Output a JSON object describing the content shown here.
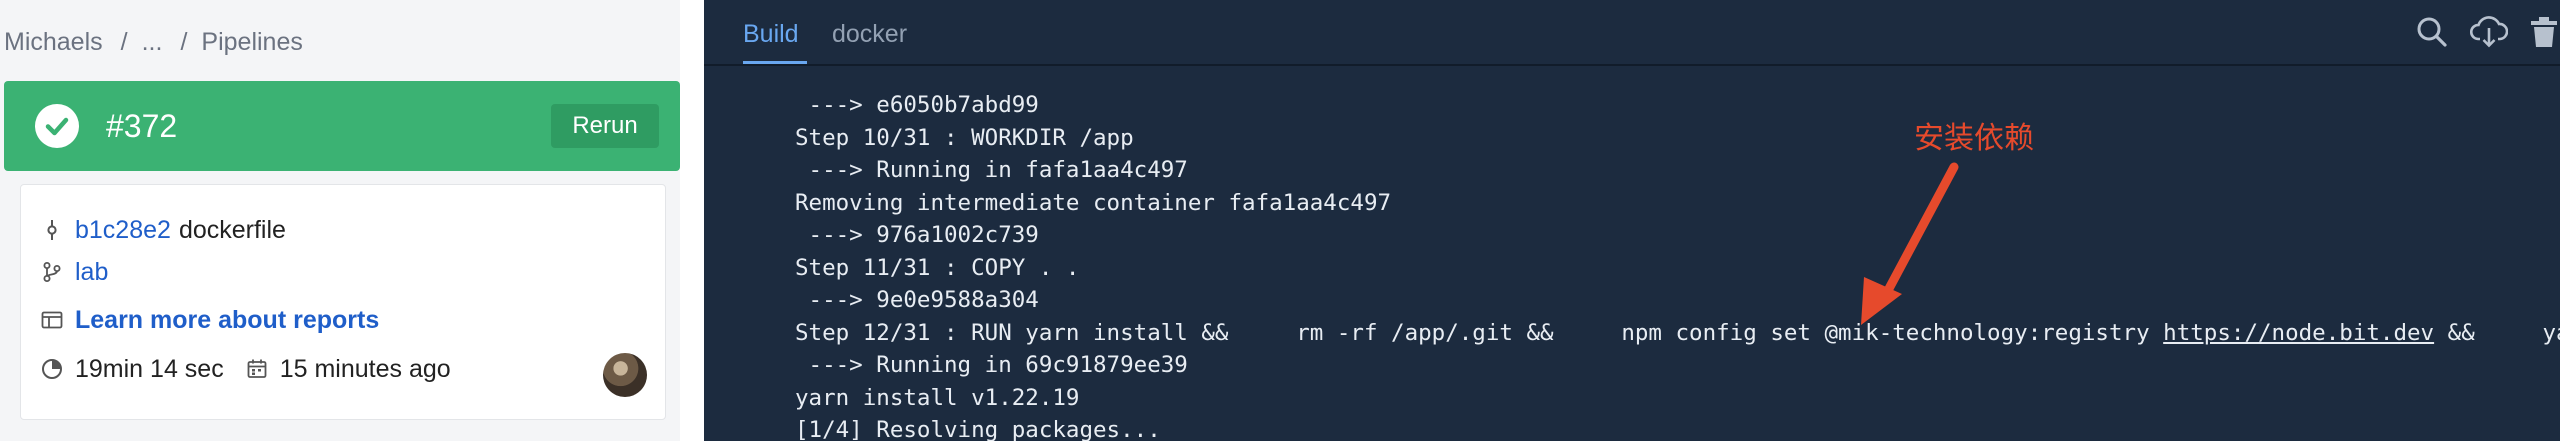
{
  "breadcrumb": {
    "items": [
      "Michaels",
      "...",
      "Pipelines"
    ],
    "separator": "/"
  },
  "pipeline": {
    "number": "#372",
    "status": "passed",
    "status_color": "#3bb273",
    "rerun_label": "Rerun"
  },
  "details": {
    "commit_hash": "b1c28e2",
    "commit_message": "dockerfile",
    "branch": "lab",
    "reports_link": "Learn more about reports",
    "duration": "19min 14 sec",
    "finished": "15 minutes ago"
  },
  "tabs": [
    "Build",
    "docker"
  ],
  "toolbar": {
    "icons": [
      "search-icon",
      "download-icon",
      "delete-icon"
    ]
  },
  "log": {
    "lines": [
      " ---> e6050b7abd99",
      "Step 10/31 : WORKDIR /app",
      " ---> Running in fafa1aa4c497",
      "Removing intermediate container fafa1aa4c497",
      " ---> 976a1002c739",
      "Step 11/31 : COPY . .",
      " ---> 9e0e9588a304",
      "Step 12/31 : RUN yarn install &&     rm -rf /app/.git &&     npm config set @mik-technology:registry ",
      " ---> Running in 69c91879ee39",
      "yarn install v1.22.19",
      "[1/4] Resolving packages..."
    ],
    "step12_link": "https://node.bit.dev",
    "step12_tail": " &&     yarn mi"
  },
  "annotation": {
    "text": "安装依赖",
    "color": "#e64a2c"
  }
}
